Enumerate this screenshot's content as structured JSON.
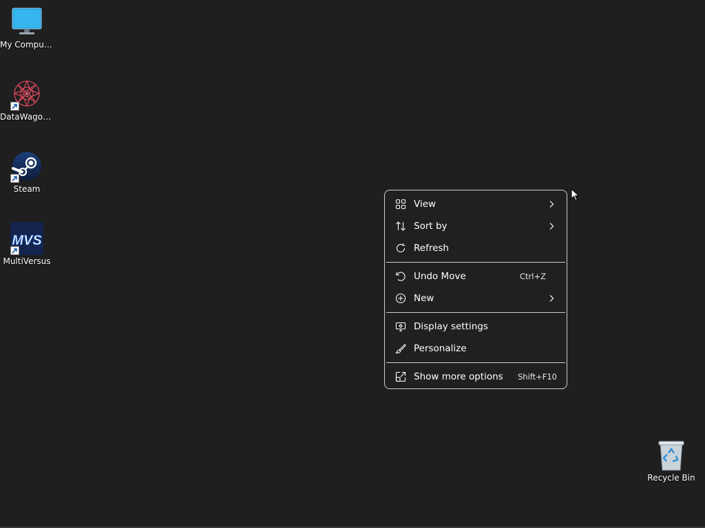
{
  "desktop": {
    "icons": [
      {
        "label": "My Computer",
        "icon": "monitor-icon",
        "shortcut": false
      },
      {
        "label": "DataWagon...",
        "icon": "datawagon-icon",
        "shortcut": true
      },
      {
        "label": "Steam",
        "icon": "steam-icon",
        "shortcut": true
      },
      {
        "label": "MultiVersus",
        "icon": "multiversus-icon",
        "shortcut": true
      },
      {
        "label": "Recycle Bin",
        "icon": "recycle-bin-icon",
        "shortcut": false
      }
    ],
    "multiversus_logo_text": "MVS"
  },
  "context_menu": {
    "items": [
      {
        "label": "View",
        "icon": "grid-icon",
        "submenu": true
      },
      {
        "label": "Sort by",
        "icon": "sort-icon",
        "submenu": true
      },
      {
        "label": "Refresh",
        "icon": "refresh-icon",
        "submenu": false
      },
      {
        "label": "Undo Move",
        "icon": "undo-icon",
        "shortcut": "Ctrl+Z"
      },
      {
        "label": "New",
        "icon": "plus-circle-icon",
        "submenu": true
      },
      {
        "label": "Display settings",
        "icon": "display-settings-icon"
      },
      {
        "label": "Personalize",
        "icon": "brush-icon"
      },
      {
        "label": "Show more options",
        "icon": "show-more-icon",
        "shortcut": "Shift+F10"
      }
    ]
  },
  "colors": {
    "background": "#1f1f1f",
    "menu_background": "#202020",
    "menu_border": "#cfcfcf",
    "text": "#ffffff"
  }
}
